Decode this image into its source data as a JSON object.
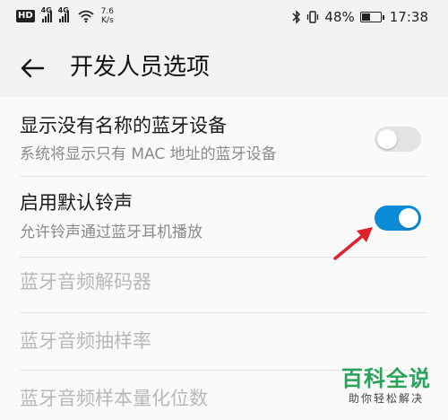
{
  "status_bar": {
    "hd_label": "HD",
    "network_label": "4G",
    "speed_value": "7.6",
    "speed_unit": "K/s",
    "battery_percent": "48%",
    "battery_level": 0.48,
    "time": "17:38",
    "icons": [
      "hd-icon",
      "signal-icon",
      "signal-icon",
      "wifi-icon",
      "bluetooth-icon",
      "vibrate-icon",
      "battery-icon"
    ]
  },
  "header": {
    "back_icon": "arrow-left-icon",
    "title": "开发人员选项"
  },
  "settings": [
    {
      "title": "显示没有名称的蓝牙设备",
      "subtitle": "系统将显示只有 MAC 地址的蓝牙设备",
      "toggle": "off"
    },
    {
      "title": "启用默认铃声",
      "subtitle": "允许铃声通过蓝牙耳机播放",
      "toggle": "on"
    },
    {
      "title": "蓝牙音频解码器",
      "enabled": false
    },
    {
      "title": "蓝牙音频抽样率",
      "enabled": false
    },
    {
      "title": "蓝牙音频样本量化位数",
      "enabled": false
    }
  ],
  "colors": {
    "toggle_on": "#0a8cd8",
    "toggle_off": "#e3e3e3",
    "annotation_arrow": "#e0202a",
    "watermark_green": "#2aa35a"
  },
  "watermark": {
    "main": "百科全说",
    "sub": "助你轻松解决"
  }
}
